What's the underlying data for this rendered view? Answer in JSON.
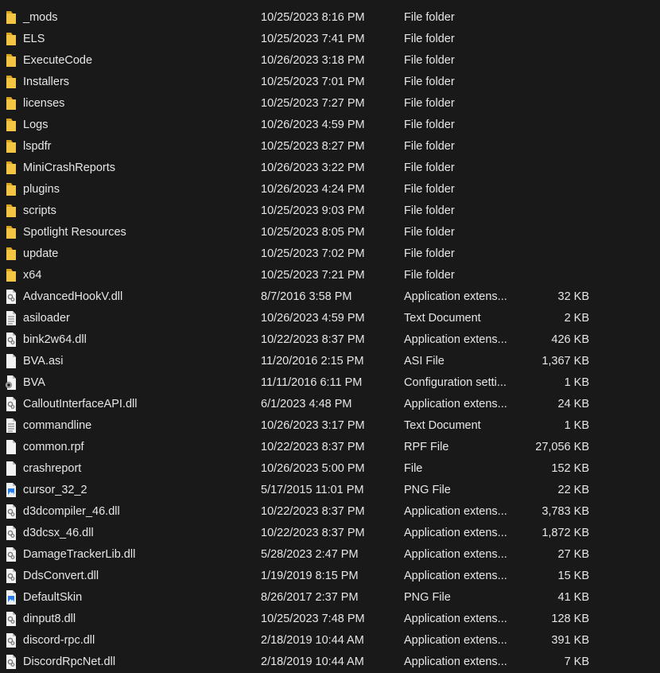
{
  "files": [
    {
      "name": "_mods",
      "date": "10/25/2023 8:16 PM",
      "type": "File folder",
      "size": "",
      "icon": "folder-icon"
    },
    {
      "name": "ELS",
      "date": "10/25/2023 7:41 PM",
      "type": "File folder",
      "size": "",
      "icon": "folder-icon"
    },
    {
      "name": "ExecuteCode",
      "date": "10/26/2023 3:18 PM",
      "type": "File folder",
      "size": "",
      "icon": "folder-icon"
    },
    {
      "name": "Installers",
      "date": "10/25/2023 7:01 PM",
      "type": "File folder",
      "size": "",
      "icon": "folder-icon"
    },
    {
      "name": "licenses",
      "date": "10/25/2023 7:27 PM",
      "type": "File folder",
      "size": "",
      "icon": "folder-icon"
    },
    {
      "name": "Logs",
      "date": "10/26/2023 4:59 PM",
      "type": "File folder",
      "size": "",
      "icon": "folder-icon"
    },
    {
      "name": "lspdfr",
      "date": "10/25/2023 8:27 PM",
      "type": "File folder",
      "size": "",
      "icon": "folder-icon"
    },
    {
      "name": "MiniCrashReports",
      "date": "10/26/2023 3:22 PM",
      "type": "File folder",
      "size": "",
      "icon": "folder-icon"
    },
    {
      "name": "plugins",
      "date": "10/26/2023 4:24 PM",
      "type": "File folder",
      "size": "",
      "icon": "folder-icon"
    },
    {
      "name": "scripts",
      "date": "10/25/2023 9:03 PM",
      "type": "File folder",
      "size": "",
      "icon": "folder-icon"
    },
    {
      "name": "Spotlight Resources",
      "date": "10/25/2023 8:05 PM",
      "type": "File folder",
      "size": "",
      "icon": "folder-icon"
    },
    {
      "name": "update",
      "date": "10/25/2023 7:02 PM",
      "type": "File folder",
      "size": "",
      "icon": "folder-icon"
    },
    {
      "name": "x64",
      "date": "10/25/2023 7:21 PM",
      "type": "File folder",
      "size": "",
      "icon": "folder-icon"
    },
    {
      "name": "AdvancedHookV.dll",
      "date": "8/7/2016 3:58 PM",
      "type": "Application extens...",
      "size": "32 KB",
      "icon": "dll-file-icon"
    },
    {
      "name": "asiloader",
      "date": "10/26/2023 4:59 PM",
      "type": "Text Document",
      "size": "2 KB",
      "icon": "text-document-icon"
    },
    {
      "name": "bink2w64.dll",
      "date": "10/22/2023 8:37 PM",
      "type": "Application extens...",
      "size": "426 KB",
      "icon": "dll-file-icon"
    },
    {
      "name": "BVA.asi",
      "date": "11/20/2016 2:15 PM",
      "type": "ASI File",
      "size": "1,367 KB",
      "icon": "blank-file-icon"
    },
    {
      "name": "BVA",
      "date": "11/11/2016 6:11 PM",
      "type": "Configuration setti...",
      "size": "1 KB",
      "icon": "config-settings-icon"
    },
    {
      "name": "CalloutInterfaceAPI.dll",
      "date": "6/1/2023 4:48 PM",
      "type": "Application extens...",
      "size": "24 KB",
      "icon": "dll-file-icon"
    },
    {
      "name": "commandline",
      "date": "10/26/2023 3:17 PM",
      "type": "Text Document",
      "size": "1 KB",
      "icon": "text-document-icon"
    },
    {
      "name": "common.rpf",
      "date": "10/22/2023 8:37 PM",
      "type": "RPF File",
      "size": "27,056 KB",
      "icon": "blank-file-icon"
    },
    {
      "name": "crashreport",
      "date": "10/26/2023 5:00 PM",
      "type": "File",
      "size": "152 KB",
      "icon": "blank-file-icon"
    },
    {
      "name": "cursor_32_2",
      "date": "5/17/2015 11:01 PM",
      "type": "PNG File",
      "size": "22 KB",
      "icon": "png-image-icon"
    },
    {
      "name": "d3dcompiler_46.dll",
      "date": "10/22/2023 8:37 PM",
      "type": "Application extens...",
      "size": "3,783 KB",
      "icon": "dll-file-icon"
    },
    {
      "name": "d3dcsx_46.dll",
      "date": "10/22/2023 8:37 PM",
      "type": "Application extens...",
      "size": "1,872 KB",
      "icon": "dll-file-icon"
    },
    {
      "name": "DamageTrackerLib.dll",
      "date": "5/28/2023 2:47 PM",
      "type": "Application extens...",
      "size": "27 KB",
      "icon": "dll-file-icon"
    },
    {
      "name": "DdsConvert.dll",
      "date": "1/19/2019 8:15 PM",
      "type": "Application extens...",
      "size": "15 KB",
      "icon": "dll-file-icon"
    },
    {
      "name": "DefaultSkin",
      "date": "8/26/2017 2:37 PM",
      "type": "PNG File",
      "size": "41 KB",
      "icon": "png-image-icon"
    },
    {
      "name": "dinput8.dll",
      "date": "10/25/2023 7:48 PM",
      "type": "Application extens...",
      "size": "128 KB",
      "icon": "dll-file-icon"
    },
    {
      "name": "discord-rpc.dll",
      "date": "2/18/2019 10:44 AM",
      "type": "Application extens...",
      "size": "391 KB",
      "icon": "dll-file-icon"
    },
    {
      "name": "DiscordRpcNet.dll",
      "date": "2/18/2019 10:44 AM",
      "type": "Application extens...",
      "size": "7 KB",
      "icon": "dll-file-icon"
    }
  ],
  "colors": {
    "background": "#191919",
    "text": "#e6e6e6",
    "folder": "#f4c542",
    "folder_dark": "#d9a520",
    "file_page": "#f2f2f2",
    "file_fold": "#bdbdbd",
    "png_accent": "#2b7de9"
  }
}
